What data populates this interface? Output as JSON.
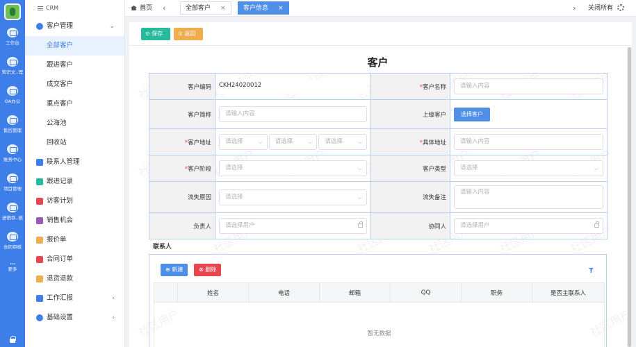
{
  "rail": {
    "items": [
      {
        "label": "工作台",
        "icon": "dashboard-icon"
      },
      {
        "label": "知识文..理",
        "icon": "knowledge-icon"
      },
      {
        "label": "OA办公",
        "icon": "office-icon"
      },
      {
        "label": "售后管理",
        "icon": "after-sales-icon"
      },
      {
        "label": "账务中心",
        "icon": "finance-icon"
      },
      {
        "label": "项目管理",
        "icon": "project-icon"
      },
      {
        "label": "进销存..统",
        "icon": "inventory-icon"
      },
      {
        "label": "合同审核",
        "icon": "contract-review-icon"
      }
    ],
    "more": {
      "dots": "...",
      "label": "更多"
    }
  },
  "sidebar": {
    "header": "CRM",
    "group": {
      "label": "客户管理",
      "chevron": "⌄"
    },
    "sub_items": [
      "全部客户",
      "跟进客户",
      "成交客户",
      "重点客户",
      "公海池",
      "回收站"
    ],
    "items": [
      {
        "label": "联系人管理",
        "color": "#3d7ee8"
      },
      {
        "label": "跟进记录",
        "color": "#26b99a"
      },
      {
        "label": "访客计划",
        "color": "#e8464f"
      },
      {
        "label": "销售机会",
        "color": "#9b59b6"
      },
      {
        "label": "报价单",
        "color": "#f0ad4e"
      },
      {
        "label": "合同订单",
        "color": "#e8464f"
      },
      {
        "label": "退货退款",
        "color": "#f0ad4e"
      },
      {
        "label": "工作汇报",
        "color": "#3d7ee8",
        "chevron": "‹"
      },
      {
        "label": "基础设置",
        "color": "#3d7ee8",
        "chevron": "‹"
      }
    ]
  },
  "topbar": {
    "home": "首页",
    "prev": "‹",
    "next": "›",
    "tabs": [
      {
        "label": "全部客户",
        "close": "×"
      },
      {
        "label": "客户信息",
        "close": "×"
      }
    ],
    "close_all": "关闭所有"
  },
  "toolbar": {
    "save": "⊙ 保存",
    "back": "⊙ 返回"
  },
  "form": {
    "title": "客户",
    "customer_code": {
      "label": "客户编码",
      "value": "CKH24020012"
    },
    "customer_name": {
      "label": "客户名称",
      "placeholder": "请输入内容"
    },
    "short_name": {
      "label": "客户简称",
      "placeholder": "请输入内容"
    },
    "parent_customer": {
      "label": "上级客户",
      "button": "选择客户"
    },
    "address": {
      "label": "客户地址",
      "placeholders": [
        "请选择",
        "请选择",
        "请选择"
      ]
    },
    "detail_address": {
      "label": "具体地址",
      "placeholder": "请输入内容"
    },
    "stage": {
      "label": "客户阶段",
      "placeholder": "请选择"
    },
    "type": {
      "label": "客户类型",
      "placeholder": "请选择"
    },
    "loss_reason": {
      "label": "流失原因",
      "placeholder": "请选择"
    },
    "loss_note": {
      "label": "流失备注",
      "placeholder": "请输入内容"
    },
    "owner": {
      "label": "负责人",
      "placeholder": "请选择用户"
    },
    "collaborator": {
      "label": "协同人",
      "placeholder": "请选择用户"
    }
  },
  "contacts": {
    "title": "联系人",
    "new_button": "⊕ 新建",
    "delete_button": "⊗ 删除",
    "columns": [
      "",
      "姓名",
      "电话",
      "邮箱",
      "QQ",
      "职务",
      "是否主联系人"
    ],
    "empty": "暂无数据"
  },
  "watermark": "社区用户",
  "colors": {
    "primary": "#3d7ee8",
    "save": "#26b99a",
    "back": "#f0ad4e",
    "danger": "#e8464f",
    "table_border": "#b6cfee"
  }
}
